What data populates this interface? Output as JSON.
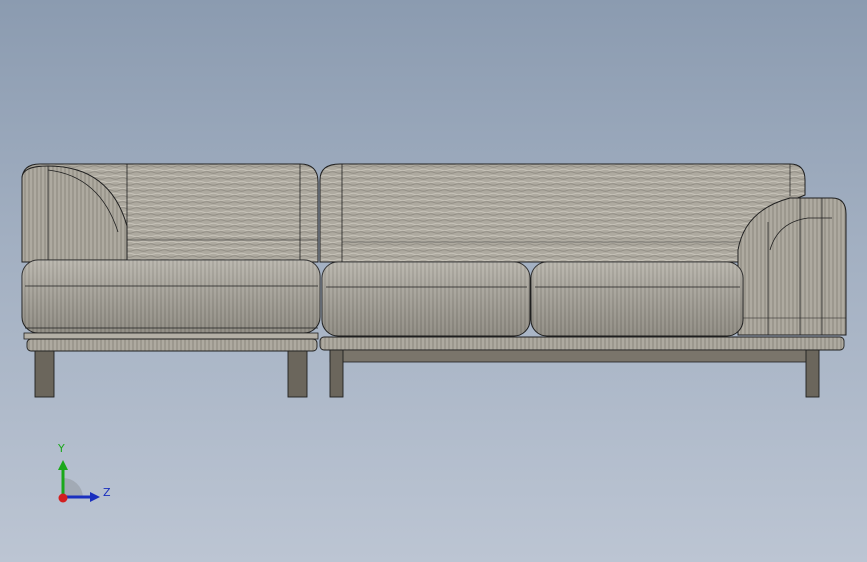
{
  "viewport": {
    "background_top": "#8b9bb0",
    "background_bottom": "#bcc5d3"
  },
  "model": {
    "name": "sofa",
    "fabric_color": "#aeaaa0",
    "fabric_shadow": "#8f8b82",
    "leg_color": "#6b665c",
    "edge_color": "#1f1f1f"
  },
  "triad": {
    "y_label": "Y",
    "z_label": "Z",
    "x_color": "#d21f1f",
    "y_color": "#1aa81a",
    "z_color": "#1a2fbf"
  }
}
